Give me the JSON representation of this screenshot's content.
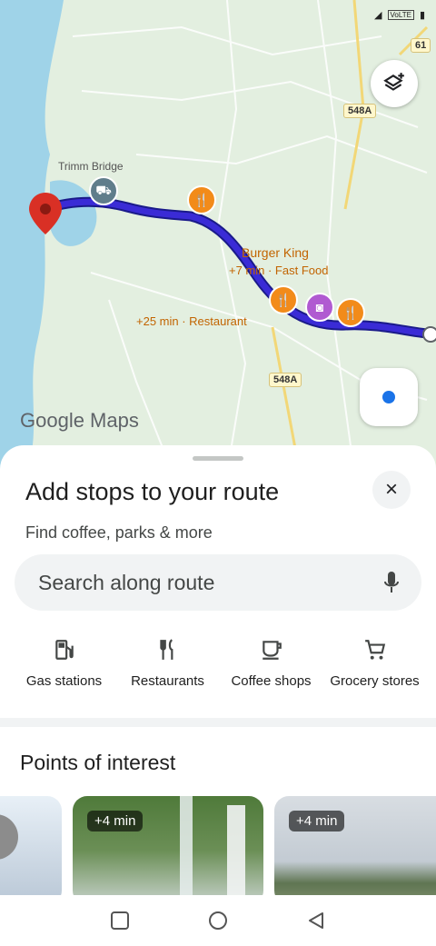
{
  "map": {
    "labels": {
      "burger_king": "Burger King",
      "burger_king_detail": "+7 min · Fast Food",
      "restaurant_detail": "+25 min · Restaurant",
      "road_548a_top": "548A",
      "road_548a_mid": "548A",
      "road_61": "61",
      "bridge": "Trimm Bridge"
    },
    "logo": "Google Maps",
    "status_bar": "VoLTE"
  },
  "sheet": {
    "title": "Add stops to your route",
    "subtitle": "Find coffee, parks & more",
    "search_placeholder": "Search along route",
    "close_label": "×",
    "categories": [
      {
        "label": "Gas stations",
        "icon": "gas-station-icon"
      },
      {
        "label": "Restaurants",
        "icon": "restaurant-icon"
      },
      {
        "label": "Coffee shops",
        "icon": "coffee-icon"
      },
      {
        "label": "Grocery stores",
        "icon": "cart-icon"
      }
    ],
    "poi_title": "Points of interest",
    "cards": [
      {
        "time": "+4 min"
      },
      {
        "time": "+4 min"
      }
    ]
  },
  "colors": {
    "route": "#3a2bd6",
    "accent": "#1a73e8",
    "poi_orange": "#f28b1a"
  }
}
